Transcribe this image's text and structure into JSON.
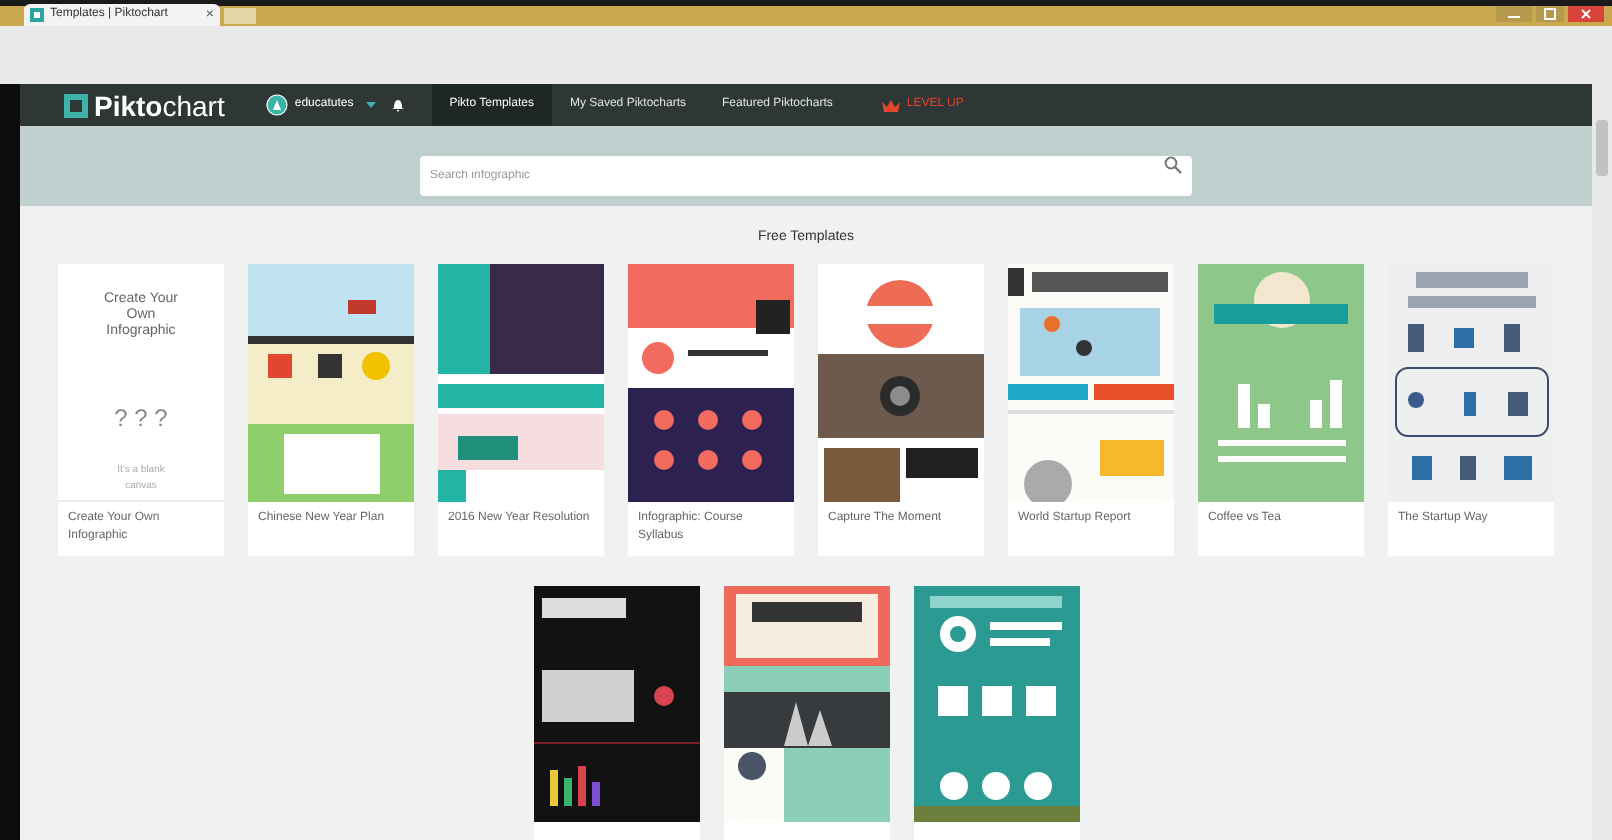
{
  "browser": {
    "tab_title": "Templates | Piktochart",
    "tab_close": "×"
  },
  "nav": {
    "logo": "**Pikto**chart",
    "user": "educatutes",
    "links": [
      {
        "label": "Pikto Templates",
        "selected": true
      },
      {
        "label": "My Saved Piktocharts",
        "selected": false
      },
      {
        "label": "Featured Piktocharts",
        "selected": false
      }
    ],
    "upgrade": "LEVEL UP"
  },
  "search": {
    "placeholder": "Search infographic"
  },
  "section_title": "Free Templates",
  "blank_card": {
    "title": "Create Your Own Infographic",
    "glyphs": "? ? ?",
    "hint": "It's a blank canvas",
    "label": "Create Your Own Infographic"
  },
  "templates": [
    {
      "label": "Chinese New Year Plan"
    },
    {
      "label": "2016 New Year Resolution"
    },
    {
      "label": "Infographic: Course Syllabus"
    },
    {
      "label": "Capture The Moment"
    },
    {
      "label": "World Startup Report"
    },
    {
      "label": "Coffee vs Tea"
    },
    {
      "label": "The Startup Way"
    }
  ]
}
